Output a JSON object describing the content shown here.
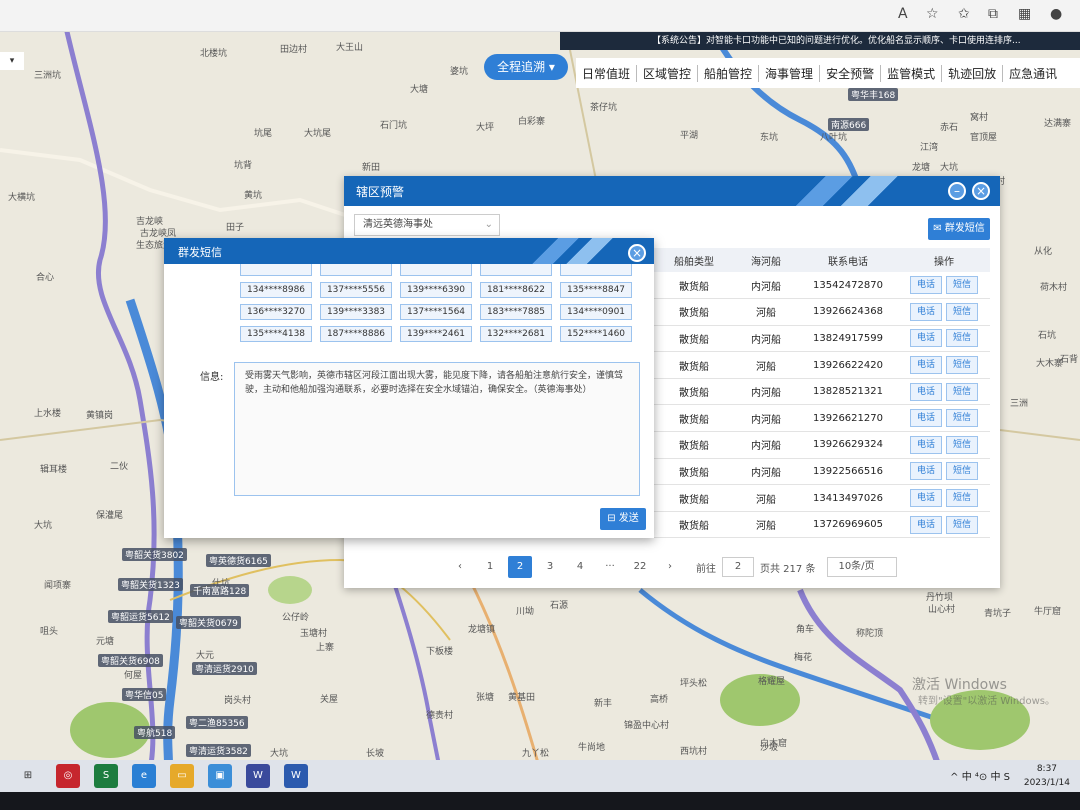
{
  "browser": {
    "icons": [
      "read-aloud-icon",
      "favorite-star-icon",
      "favorites-icon",
      "collections-icon",
      "extensions-icon",
      "profile-avatar-icon"
    ]
  },
  "notice": "【系统公告】对智能卡口功能中已知的问题进行优化。优化船名显示顺序、卡口使用连排序...",
  "top_left_dropdown": "▾",
  "trace_button": "全程追溯",
  "nav": [
    "日常值班",
    "区域管控",
    "船舶管控",
    "海事管理",
    "安全预警",
    "监管模式",
    "轨迹回放",
    "应急通讯"
  ],
  "map_labels": [
    "三洲坑",
    "北楼坑",
    "田边村",
    "大王山",
    "婆坑",
    "白云石",
    "大塘",
    "石门坑",
    "坑尾",
    "大坑尾",
    "大坪",
    "白彩寨",
    "茶仔坑",
    "大横坑",
    "吉龙峡",
    "黄坑",
    "新田",
    "坑背",
    "田子",
    "古龙峡凤",
    "生态旅游区",
    "合心",
    "上水楼",
    "黄镇岗",
    "二伙",
    "辑耳楼",
    "保灌尾",
    "大坑",
    "闻项寨",
    "咀头",
    "元塘",
    "大元",
    "上寨",
    "下板楼",
    "龙塘镇",
    "川坳",
    "石源",
    "张塘",
    "岗头村",
    "关屋",
    "黄基田",
    "德贵村",
    "何屋",
    "大坑",
    "长坡",
    "九丫松",
    "牛尚地",
    "锦盈中心村",
    "新丰",
    "坪头松",
    "高桥",
    "格耀屋",
    "沙坡",
    "西坑村",
    "白木窟",
    "丹竹坝",
    "山心村",
    "青坑子",
    "牛厅窟",
    "大木寨",
    "石坑",
    "石背",
    "从化",
    "荷木村",
    "达满寨",
    "窝村",
    "官顶屋",
    "大坑",
    "东门",
    "仕坑",
    "公仔岭",
    "玉塘村",
    "梅花",
    "角车",
    "称陀顶",
    "龙塘",
    "江湾",
    "赤石",
    "平湖",
    "东坑",
    "牛尾",
    "黄洞口",
    "东来",
    "坪石村",
    "庞田",
    "八叶坑",
    "三洲",
    "大坪",
    "龙门坑"
  ],
  "ships": [
    "粤华丰168",
    "南源666",
    "粤韶关货3802",
    "粤英德货6165",
    "粤韶关货1323",
    "千南富路128",
    "粤韶运货5612",
    "粤韶关货0679",
    "粤韶关货6908",
    "粤清运货2910",
    "粤华信05",
    "粤二渔85356",
    "粤航518",
    "粤清运货3582"
  ],
  "panel": {
    "title": "辖区预警",
    "agency_select": "清远英德海事处",
    "group_sms_button": "群发短信",
    "columns": [
      "船舶类型",
      "海河船",
      "联系电话",
      "操作"
    ],
    "rows": [
      {
        "type": "散货船",
        "river": "内河船",
        "phone": "13542472870"
      },
      {
        "type": "散货船",
        "river": "河船",
        "phone": "13926624368"
      },
      {
        "type": "散货船",
        "river": "内河船",
        "phone": "13824917599"
      },
      {
        "type": "散货船",
        "river": "河船",
        "phone": "13926622420"
      },
      {
        "type": "散货船",
        "river": "内河船",
        "phone": "13828521321"
      },
      {
        "type": "散货船",
        "river": "内河船",
        "phone": "13926621270"
      },
      {
        "type": "散货船",
        "river": "内河船",
        "phone": "13926629324"
      },
      {
        "type": "散货船",
        "river": "内河船",
        "phone": "13922566516"
      },
      {
        "type": "散货船",
        "river": "河船",
        "phone": "13413497026"
      },
      {
        "type": "散货船",
        "river": "河船",
        "phone": "13726969605"
      }
    ],
    "call_label": "电话",
    "sms_label": "短信",
    "pager": {
      "prev": "‹",
      "pages": [
        "1",
        "2",
        "3",
        "4",
        "···",
        "22"
      ],
      "next": "›",
      "goto_label": "前往",
      "goto_value": "2",
      "total": "页共 217 条",
      "page_size": "10条/页"
    }
  },
  "dialog": {
    "title": "群发短信",
    "phones": [
      [
        "134****8986",
        "137****5556",
        "139****6390",
        "181****8622",
        "135****8847"
      ],
      [
        "136****3270",
        "139****3383",
        "137****1564",
        "183****7885",
        "134****0901"
      ],
      [
        "135****4138",
        "187****8886",
        "139****2461",
        "132****2681",
        "152****1460"
      ]
    ],
    "info_label": "信息:",
    "message": "受雨雾天气影响，英德市辖区河段江面出现大雾，能见度下降，请各船舶注意航行安全，谨慎驾驶，主动和他船加强沟通联系，必要时选择在安全水域锚泊，确保安全。（英德海事处）",
    "send_button": "发送"
  },
  "watermark": {
    "line1": "激活 Windows",
    "line2": "转到\"设置\"以激活 Windows。"
  },
  "taskbar": {
    "tray": "^ 中 ⁴⊙ 中 S",
    "time": "8:37",
    "date": "2023/1/14",
    "ime": "中"
  }
}
